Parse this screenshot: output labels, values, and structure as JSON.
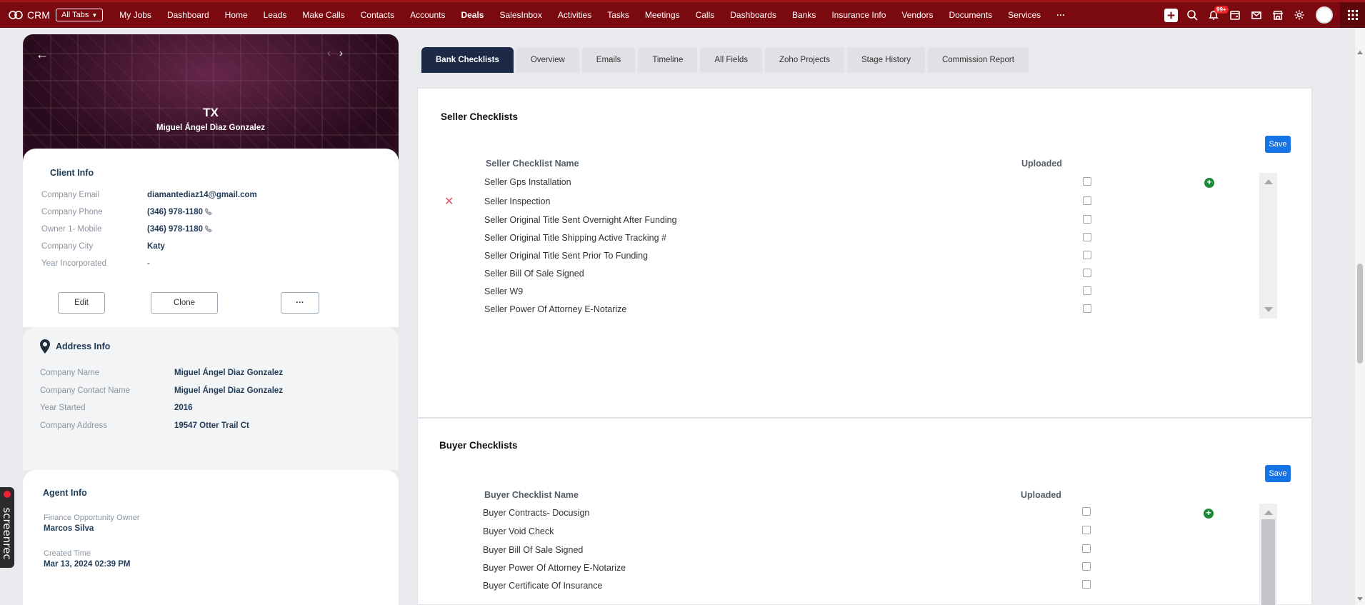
{
  "topnav": {
    "brand": "CRM",
    "all_tabs": "All Tabs",
    "links": [
      "My Jobs",
      "Dashboard",
      "Home",
      "Leads",
      "Make Calls",
      "Contacts",
      "Accounts",
      "Deals",
      "SalesInbox",
      "Activities",
      "Tasks",
      "Meetings",
      "Calls",
      "Dashboards",
      "Banks",
      "Insurance Info",
      "Vendors",
      "Documents",
      "Services"
    ],
    "active_link": "Deals",
    "more_icon": "ellipsis-icon",
    "notification_badge": "99+",
    "icons": [
      "plus-icon",
      "search-icon",
      "bell-icon",
      "calendar-icon",
      "mail-icon",
      "store-icon",
      "gear-icon",
      "avatar",
      "apps-grid-icon"
    ]
  },
  "hero": {
    "title": "TX",
    "subtitle": "Miguel Ángel Dìaz Gonzalez",
    "back_icon": "arrow-left-icon",
    "prev_icon": "chevron-left-icon",
    "next_icon": "chevron-right-icon"
  },
  "client_info": {
    "heading": "Client Info",
    "fields": [
      {
        "label": "Company Email",
        "value": "diamantediaz14@gmail.com"
      },
      {
        "label": "Company Phone",
        "value": "(346) 978-1180"
      },
      {
        "label": "Owner 1- Mobile",
        "value": "(346) 978-1180"
      },
      {
        "label": "Company City",
        "value": "Katy"
      },
      {
        "label": "Year Incorporated",
        "value": "-"
      }
    ],
    "buttons": {
      "edit": "Edit",
      "clone": "Clone",
      "more": "···"
    }
  },
  "address_info": {
    "heading": "Address Info",
    "fields": [
      {
        "label": "Company Name",
        "value": "Miguel Ángel Dìaz Gonzalez"
      },
      {
        "label": "Company Contact Name",
        "value": "Miguel Ángel Dìaz Gonzalez"
      },
      {
        "label": "Year Started",
        "value": "2016"
      },
      {
        "label": "Company Address",
        "value": "19547 Otter Trail Ct"
      }
    ]
  },
  "agent_info": {
    "heading": "Agent Info",
    "fields": [
      {
        "label": "Finance Opportunity Owner",
        "value": "Marcos Silva"
      },
      {
        "label": "Created Time",
        "value": "Mar 13, 2024 02:39 PM"
      }
    ]
  },
  "screenrec": "screenrec",
  "tabs": [
    "Bank Checklists",
    "Overview",
    "Emails",
    "Timeline",
    "All Fields",
    "Zoho Projects",
    "Stage History",
    "Commission Report"
  ],
  "active_tab": "Bank Checklists",
  "seller": {
    "title": "Seller Checklists",
    "save": "Save",
    "col_name": "Seller Checklist Name",
    "col_uploaded": "Uploaded",
    "items": [
      {
        "name": "Seller Gps Installation",
        "uploaded": false
      },
      {
        "name": "Seller Inspection",
        "uploaded": false
      },
      {
        "name": "Seller Original Title Sent Overnight After Funding",
        "uploaded": false
      },
      {
        "name": "Seller Original Title Shipping Active Tracking #",
        "uploaded": false
      },
      {
        "name": "Seller Original Title Sent Prior To Funding",
        "uploaded": false
      },
      {
        "name": "Seller Bill Of Sale Signed",
        "uploaded": false
      },
      {
        "name": "Seller W9",
        "uploaded": false
      },
      {
        "name": "Seller Power Of Attorney E-Notarize",
        "uploaded": false
      }
    ]
  },
  "buyer": {
    "title": "Buyer Checklists",
    "save": "Save",
    "col_name": "Buyer Checklist Name",
    "col_uploaded": "Uploaded",
    "items": [
      {
        "name": "Buyer Contracts- Docusign",
        "uploaded": false
      },
      {
        "name": "Buyer Void Check",
        "uploaded": false
      },
      {
        "name": "Buyer Bill Of Sale Signed",
        "uploaded": false
      },
      {
        "name": "Buyer Power Of Attorney E-Notarize",
        "uploaded": false
      },
      {
        "name": "Buyer Certificate Of Insurance",
        "uploaded": false
      }
    ]
  },
  "colors": {
    "nav_bg": "#7a0a10",
    "active_tab": "#1c2a47",
    "save_btn": "#1673e6",
    "add_icon": "#1a8a3a",
    "delete_icon": "#e2566a"
  }
}
